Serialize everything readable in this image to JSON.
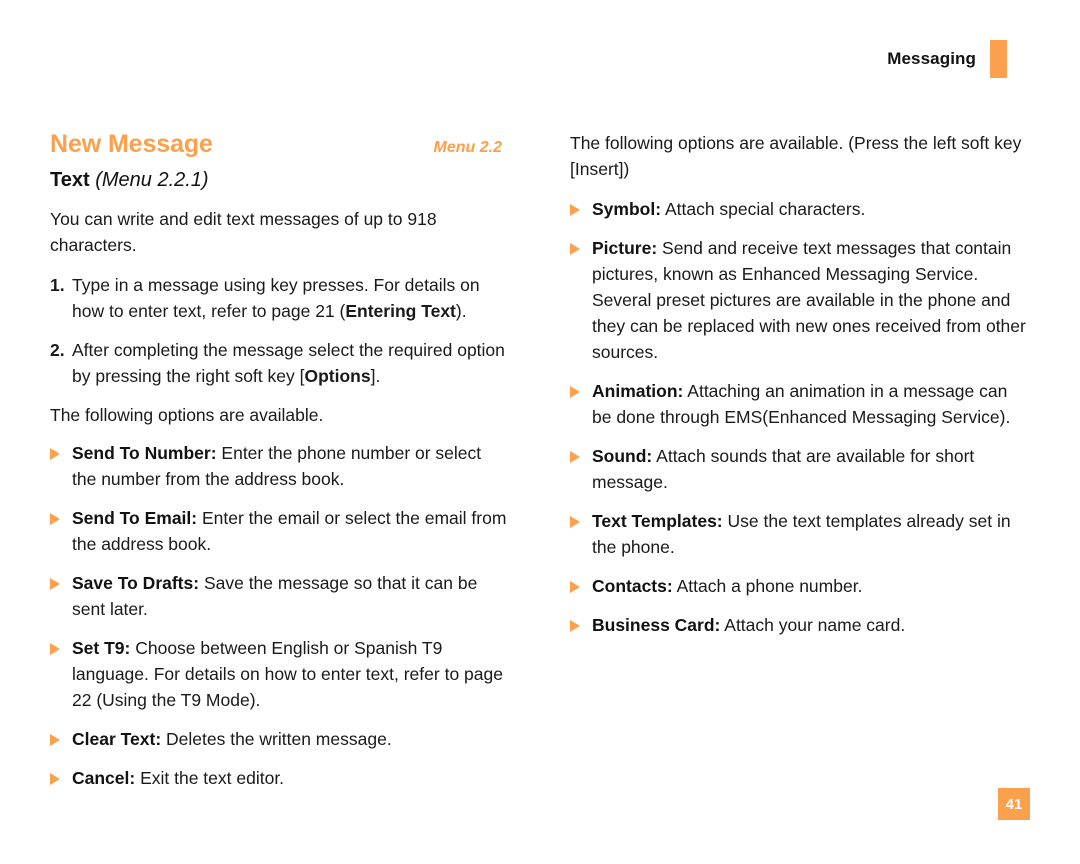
{
  "header": {
    "chapter": "Messaging"
  },
  "page_number": "41",
  "left_column": {
    "section_title": "New Message",
    "section_menu": "Menu 2.2",
    "sub_title": "Text",
    "sub_menu": "(Menu 2.2.1)",
    "intro": "You can write and edit text messages of up to 918 characters.",
    "steps": [
      {
        "num": "1.",
        "text_before": "Type in a message using key presses. For details on how to enter text, refer to page 21 (",
        "bold": "Entering Text",
        "text_after": ")."
      },
      {
        "num": "2.",
        "text_before": "After completing the message select the required option by pressing the right soft key [",
        "bold": "Options",
        "text_after": "]."
      }
    ],
    "options_lead": "The following options are available.",
    "bullets": [
      {
        "label": "Send To Number:",
        "text": " Enter the phone number or select the number from the address book."
      },
      {
        "label": "Send To Email:",
        "text": " Enter the email or select the email from the address book."
      },
      {
        "label": "Save To Drafts:",
        "text": " Save the message so that it can be sent later."
      },
      {
        "label": "Set T9:",
        "text": " Choose between English or Spanish T9 language. For details on how to enter text, refer to page 22 (Using the T9 Mode)."
      },
      {
        "label": "Clear Text:",
        "text": " Deletes the written message."
      },
      {
        "label": "Cancel:",
        "text": " Exit the text editor."
      }
    ]
  },
  "right_column": {
    "intro": "The following options are available. (Press the left soft key [Insert])",
    "bullets": [
      {
        "label": "Symbol:",
        "text": " Attach special characters."
      },
      {
        "label": "Picture:",
        "text": " Send and receive text messages that contain pictures, known as Enhanced Messaging Service. Several preset pictures are available in the phone and they can be replaced with new ones received from other sources."
      },
      {
        "label": "Animation:",
        "text": " Attaching an animation in a message can be done through EMS(Enhanced Messaging Service)."
      },
      {
        "label": "Sound:",
        "text": " Attach sounds that are available for short message."
      },
      {
        "label": "Text Templates:",
        "text": " Use the text templates already set in the phone."
      },
      {
        "label": "Contacts:",
        "text": " Attach a phone number."
      },
      {
        "label": "Business Card:",
        "text": " Attach your name card."
      }
    ]
  },
  "colors": {
    "accent": "#fba04c",
    "text": "#1a1a1a"
  }
}
